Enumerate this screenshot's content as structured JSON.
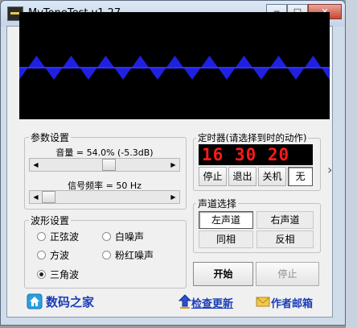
{
  "window": {
    "title": "MyToneTest v1.27",
    "min": "─",
    "max": "□",
    "close": "✕"
  },
  "params": {
    "group_label": "参数设置",
    "volume_caption": "音量 = 54.0% (-5.3dB)",
    "volume_level": 0.54,
    "freq_caption": "信号频率 = 50 Hz",
    "freq_level": 0.0,
    "scroll_left": "◀",
    "scroll_right": "▶"
  },
  "timer": {
    "group_label": "定时器(请选择到时的动作)",
    "time": "16 30 20",
    "actions": [
      {
        "label": "停止",
        "selected": false
      },
      {
        "label": "退出",
        "selected": false
      },
      {
        "label": "关机",
        "selected": false
      },
      {
        "label": "无",
        "selected": true
      }
    ]
  },
  "waveform": {
    "group_label": "波形设置",
    "options": [
      {
        "label": "正弦波",
        "checked": false
      },
      {
        "label": "白噪声",
        "checked": false
      },
      {
        "label": "方波",
        "checked": false
      },
      {
        "label": "粉红噪声",
        "checked": false
      },
      {
        "label": "三角波",
        "checked": true
      }
    ]
  },
  "channel": {
    "group_label": "声道选择",
    "left": "左声道",
    "right": "右声道",
    "in_phase": "同相",
    "inverted": "反相"
  },
  "controls": {
    "start": "开始",
    "stop": "停止"
  },
  "footer": {
    "home": "数码之家",
    "update": "检查更新",
    "mail": "作者邮箱"
  },
  "side_arrow": "›",
  "colors": {
    "scope_bg": "#000000",
    "wave": "#2020e0",
    "digits": "#ff1a1a",
    "link": "#1a3eb5",
    "frame": "#cfdcea"
  }
}
